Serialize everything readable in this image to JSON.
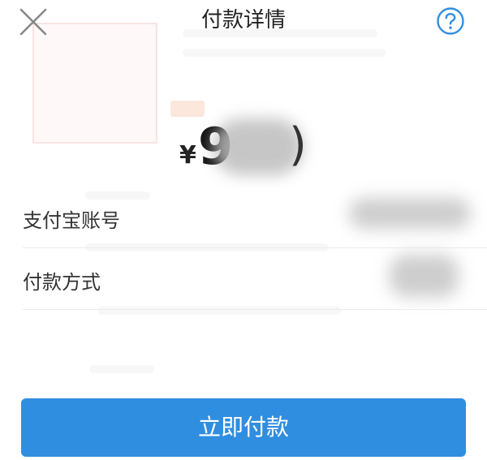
{
  "header": {
    "title": "付款详情",
    "close_icon": "close-icon",
    "help_icon": "help-icon"
  },
  "payment": {
    "currency_symbol": "¥",
    "amount_visible": "9",
    "amount_suffix": ")"
  },
  "rows": {
    "alipay_account_label": "支付宝账号",
    "payment_method_label": "付款方式"
  },
  "actions": {
    "pay_label": "立即付款"
  },
  "colors": {
    "accent": "#2f8ee0",
    "help_icon": "#2f8ee0",
    "text": "#333333"
  }
}
